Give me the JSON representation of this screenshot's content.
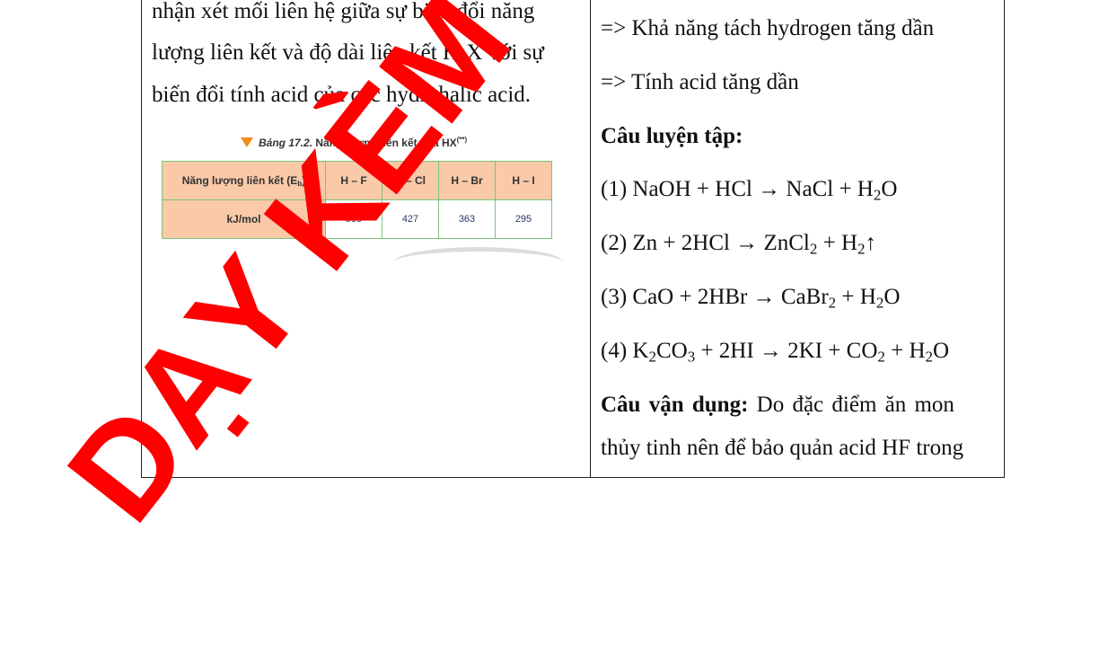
{
  "left_column": {
    "paragraph_lines": [
      "nhận xét mối liên hệ giữa sự biến đổi năng",
      "lượng liên kết và độ dài liên kết H-X với sự",
      "biến đổi tính acid của các hydrohalic acid."
    ],
    "figure": {
      "caption_prefix": "Bảng 17.2.",
      "caption_text": "Năng lượng liên kết của HX",
      "caption_mark": "(**)",
      "row_header_label": "Năng lượng liên kết (E",
      "row_header_sub": "b",
      "row_header_close": ")",
      "columns": [
        "H – F",
        "H – Cl",
        "H – Br",
        "H – I"
      ],
      "unit_label": "kJ/mol",
      "values": [
        "565",
        "427",
        "363",
        "295"
      ]
    }
  },
  "right_column": {
    "line_1": "=> Khả năng tách hydrogen tăng dần",
    "line_2": "=> Tính acid tăng dần",
    "practice_heading": "Câu luyện tập:",
    "eq1": {
      "a": "(1) NaOH + HCl → NaCl + H",
      "s1": "2",
      "b": "O"
    },
    "eq2": {
      "a": "(2) Zn + 2HCl → ZnCl",
      "s1": "2",
      "b": " + H",
      "s2": "2",
      "c": "↑"
    },
    "eq3": {
      "a": "(3) CaO + 2HBr → CaBr",
      "s1": "2",
      "b": " + H",
      "s2": "2",
      "c": "O"
    },
    "eq4": {
      "a": "(4) K",
      "s1": "2",
      "b": "CO",
      "s2": "3",
      "c": " + 2HI → 2KI + CO",
      "s3": "2",
      "d": " + H",
      "s4": "2",
      "e": "O"
    },
    "apply_heading": "Câu vận dụng:",
    "apply_line_1_rest": " Do đặc điểm ăn mon",
    "apply_line_2": "thủy tinh nên để bảo quản acid HF trong"
  },
  "watermark": {
    "text": "DẠY KÈM",
    "color": "#ff0000"
  }
}
